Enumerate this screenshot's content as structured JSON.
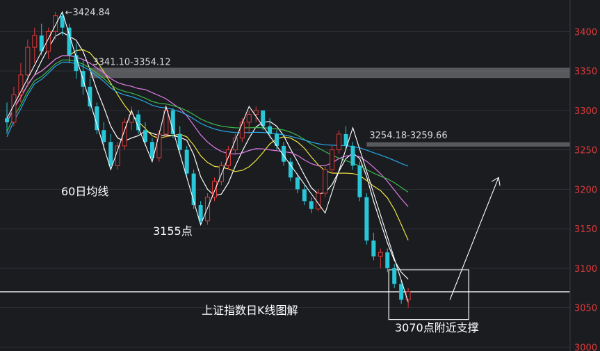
{
  "chart_data": {
    "type": "candlestick",
    "title": "上证指数日K线图解",
    "ylim": [
      2995,
      3440
    ],
    "yticks": [
      3000,
      3050,
      3100,
      3150,
      3200,
      3250,
      3300,
      3350,
      3400
    ],
    "colors": {
      "up": "#e03a3a",
      "down": "#29c6d8",
      "grid": "#2e3036",
      "tick": "#e03a3a"
    },
    "candles": [
      [
        3290,
        3310,
        3270,
        3285
      ],
      [
        3285,
        3330,
        3280,
        3320
      ],
      [
        3320,
        3360,
        3310,
        3345
      ],
      [
        3345,
        3390,
        3330,
        3380
      ],
      [
        3380,
        3405,
        3360,
        3395
      ],
      [
        3395,
        3410,
        3370,
        3375
      ],
      [
        3375,
        3405,
        3365,
        3400
      ],
      [
        3400,
        3425,
        3390,
        3420
      ],
      [
        3420,
        3424.84,
        3395,
        3405
      ],
      [
        3405,
        3410,
        3360,
        3370
      ],
      [
        3370,
        3385,
        3340,
        3350
      ],
      [
        3350,
        3365,
        3320,
        3330
      ],
      [
        3330,
        3340,
        3300,
        3305
      ],
      [
        3305,
        3310,
        3270,
        3275
      ],
      [
        3275,
        3285,
        3250,
        3260
      ],
      [
        3260,
        3270,
        3225,
        3230
      ],
      [
        3230,
        3260,
        3225,
        3255
      ],
      [
        3255,
        3290,
        3250,
        3285
      ],
      [
        3285,
        3305,
        3275,
        3295
      ],
      [
        3295,
        3300,
        3270,
        3275
      ],
      [
        3275,
        3285,
        3255,
        3260
      ],
      [
        3260,
        3265,
        3235,
        3240
      ],
      [
        3240,
        3275,
        3235,
        3270
      ],
      [
        3270,
        3305,
        3265,
        3300
      ],
      [
        3300,
        3303,
        3265,
        3270
      ],
      [
        3270,
        3280,
        3245,
        3250
      ],
      [
        3250,
        3255,
        3215,
        3220
      ],
      [
        3220,
        3225,
        3175,
        3180
      ],
      [
        3180,
        3185,
        3155,
        3160
      ],
      [
        3160,
        3195,
        3155,
        3190
      ],
      [
        3190,
        3215,
        3185,
        3210
      ],
      [
        3210,
        3235,
        3205,
        3230
      ],
      [
        3230,
        3255,
        3225,
        3250
      ],
      [
        3250,
        3270,
        3245,
        3265
      ],
      [
        3265,
        3290,
        3260,
        3285
      ],
      [
        3285,
        3300,
        3270,
        3295
      ],
      [
        3295,
        3305,
        3285,
        3300
      ],
      [
        3300,
        3298,
        3275,
        3280
      ],
      [
        3280,
        3290,
        3265,
        3270
      ],
      [
        3270,
        3275,
        3250,
        3255
      ],
      [
        3255,
        3260,
        3230,
        3235
      ],
      [
        3235,
        3240,
        3210,
        3215
      ],
      [
        3215,
        3220,
        3195,
        3200
      ],
      [
        3200,
        3205,
        3180,
        3185
      ],
      [
        3185,
        3190,
        3170,
        3175
      ],
      [
        3175,
        3200,
        3172,
        3195
      ],
      [
        3195,
        3230,
        3190,
        3225
      ],
      [
        3225,
        3255,
        3220,
        3250
      ],
      [
        3250,
        3275,
        3245,
        3270
      ],
      [
        3270,
        3280,
        3250,
        3255
      ],
      [
        3255,
        3260,
        3225,
        3230
      ],
      [
        3230,
        3235,
        3185,
        3190
      ],
      [
        3190,
        3195,
        3130,
        3135
      ],
      [
        3135,
        3145,
        3110,
        3115
      ],
      [
        3115,
        3125,
        3100,
        3120
      ],
      [
        3120,
        3125,
        3095,
        3100
      ],
      [
        3100,
        3105,
        3075,
        3080
      ],
      [
        3080,
        3085,
        3055,
        3060
      ],
      [
        3060,
        3075,
        3050,
        3070
      ]
    ],
    "annotations": [
      {
        "text": "3424.84",
        "x": 8,
        "y": 3424.84
      },
      {
        "text": "3341.10-3354.12",
        "x": 12,
        "y": 3362
      },
      {
        "text": "3254.18-3259.66",
        "x": 52,
        "y": 3269
      }
    ],
    "support_zones": [
      {
        "from": 3341.1,
        "to": 3354.12,
        "x_start": 12
      },
      {
        "from": 3254.18,
        "to": 3259.66,
        "x_start": 52
      }
    ],
    "support_line": 3070,
    "labels": {
      "ma60": "60日均线",
      "low": "3155点",
      "support": "3070点附近支撑"
    }
  }
}
